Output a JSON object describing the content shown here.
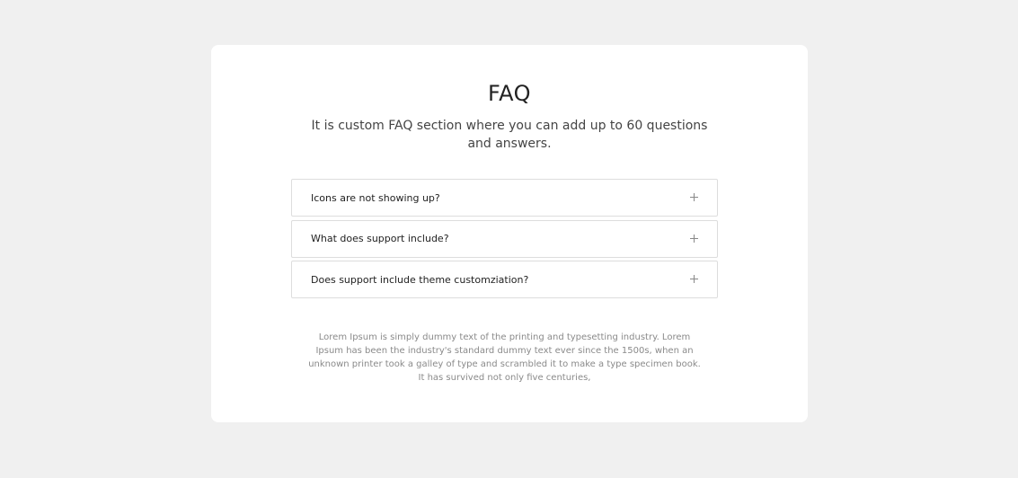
{
  "faq": {
    "title": "FAQ",
    "subtitle": "It is custom FAQ section where you can add up to 60 questions and answers.",
    "items": [
      {
        "question": "Icons are not showing up?",
        "icon": "plus-icon"
      },
      {
        "question": "What does support include?",
        "icon": "plus-icon"
      },
      {
        "question": "Does support include theme customziation?",
        "icon": "plus-icon"
      }
    ],
    "body": "Lorem Ipsum is simply dummy text of the printing and typesetting industry. Lorem Ipsum has been the industry's standard dummy text ever since the 1500s, when an unknown printer took a galley of type and scrambled it to make a type specimen book. It has survived not only five centuries,"
  },
  "colors": {
    "background": "#f0f0f0",
    "card": "#ffffff",
    "border": "#dddddd"
  }
}
